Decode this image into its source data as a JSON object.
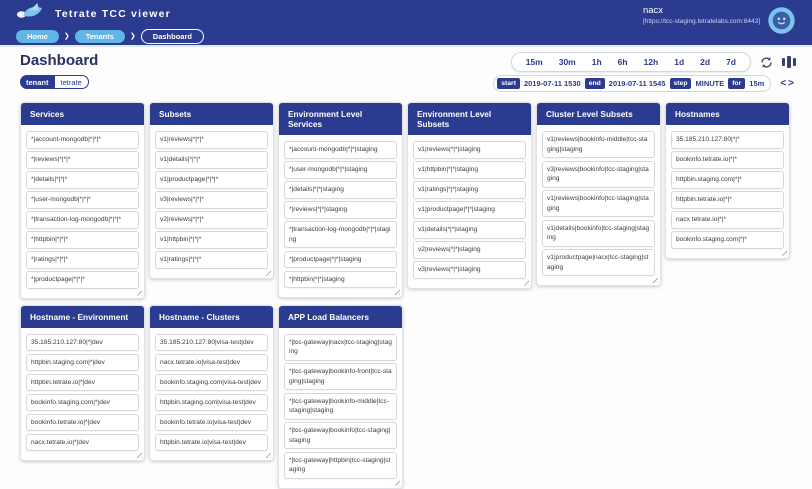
{
  "colors": {
    "navy": "#2b3b8f",
    "light_blue": "#62b5e5",
    "page_background": "#fdfdfe"
  },
  "header": {
    "app_title": "Tetrate TCC viewer",
    "logo_icon": "tetrate-bird-logo",
    "user_name": "nacx",
    "server_url": "[https://tcc-staging.tetratelabs.com:8443]",
    "avatar_icon": "user-avatar"
  },
  "breadcrumbs": {
    "chevron_glyph": "❯",
    "items": [
      {
        "label": "Home",
        "style": "filled"
      },
      {
        "label": "Tenants",
        "style": "filled"
      },
      {
        "label": "Dashboard",
        "style": "outlined"
      }
    ]
  },
  "page": {
    "title": "Dashboard",
    "tenant_badge": {
      "key": "tenant",
      "value": "tetrate"
    }
  },
  "time_toolbar": {
    "ranges": [
      "15m",
      "30m",
      "1h",
      "6h",
      "12h",
      "1d",
      "2d",
      "7d"
    ],
    "fields": [
      {
        "key": "start",
        "value": "2019-07-11 1530"
      },
      {
        "key": "end",
        "value": "2019-07-11 1545"
      },
      {
        "key": "step",
        "value": "MINUTE"
      },
      {
        "key": "for",
        "value": "15m"
      }
    ],
    "refresh_icon": "refresh-icon",
    "columns_icon": "columns-view-icon",
    "code_icon_glyph": "<>"
  },
  "cards": [
    {
      "title": "Services",
      "items": [
        "*|account-mongodb|*|*|*",
        "*|reviews|*|*|*",
        "*|details|*|*|*",
        "*|user-mongodb|*|*|*",
        "*|transaction-log-mongodb|*|*|*",
        "*|httpbin|*|*|*",
        "*|ratings|*|*|*",
        "*|productpage|*|*|*"
      ]
    },
    {
      "title": "Subsets",
      "items": [
        "v1|reviews|*|*|*",
        "v1|details|*|*|*",
        "v1|productpage|*|*|*",
        "v3|reviews|*|*|*",
        "v2|reviews|*|*|*",
        "v1|httpbin|*|*|*",
        "v1|ratings|*|*|*"
      ]
    },
    {
      "title": "Environment Level Services",
      "items": [
        "*|account-mongodb|*|*|staging",
        "*|user-mongodb|*|*|staging",
        "*|details|*|*|staging",
        "*|reviews|*|*|staging",
        "*|transaction-log-mongodb|*|*|staging",
        "*|productpage|*|*|staging",
        "*|httpbin|*|*|staging"
      ]
    },
    {
      "title": "Environment Level Subsets",
      "items": [
        "v1|reviews|*|*|staging",
        "v1|httpbin|*|*|staging",
        "v1|ratings|*|*|staging",
        "v1|productpage|*|*|staging",
        "v1|details|*|*|staging",
        "v2|reviews|*|*|staging",
        "v3|reviews|*|*|staging"
      ]
    },
    {
      "title": "Cluster Level Subsets",
      "items": [
        "v1|reviews|bookinfo-middle|tcc-staging|staging",
        "v3|reviews|bookinfo|tcc-staging|staging",
        "v1|reviews|bookinfo|tcc-staging|staging",
        "v1|details|bookinfo|tcc-staging|staging",
        "v1|productpage|nacx|tcc-staging|staging"
      ]
    },
    {
      "title": "Hostnames",
      "items": [
        "35.185.210.127:80|*|*",
        "bookinfo.tetrate.io|*|*",
        "httpbin.staging.com|*|*",
        "httpbin.tetrate.io|*|*",
        "nacx.tetrate.io|*|*",
        "bookinfo.staging.com|*|*"
      ]
    },
    {
      "title": "Hostname - Environment",
      "items": [
        "35.185.210.127:80|*|dev",
        "httpbin.staging.com|*|dev",
        "httpbin.tetrate.io|*|dev",
        "bookinfo.staging.com|*|dev",
        "bookinfo.tetrate.io|*|dev",
        "nacx.tetrate.io|*|dev"
      ]
    },
    {
      "title": "Hostname - Clusters",
      "items": [
        "35.185.210.127:80|visa-test|dev",
        "nacx.tetrate.io|visa-test|dev",
        "bookinfo.staging.com|visa-test|dev",
        "httpbin.staging.com|visa-test|dev",
        "bookinfo.tetrate.io|visa-test|dev",
        "httpbin.tetrate.io|visa-test|dev"
      ]
    },
    {
      "title": "APP Load Balancers",
      "items": [
        "*|tcc-gateway|nacx|tcc-staging|staging",
        "*|tcc-gateway|bookinfo-front|tcc-staging|staging",
        "*|tcc-gateway|bookinfo-middle|tcc-staging|staging",
        "*|tcc-gateway|bookinfo|tcc-staging|staging",
        "*|tcc-gateway|httpbin|tcc-staging|staging"
      ]
    }
  ]
}
